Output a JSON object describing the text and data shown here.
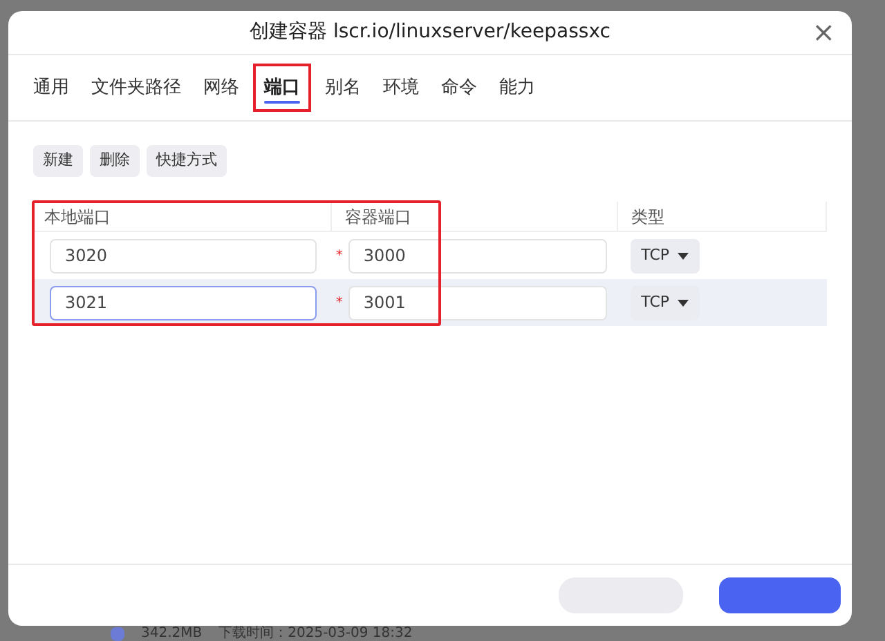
{
  "dialog": {
    "title": "创建容器 lscr.io/linuxserver/keepassxc",
    "close": "×"
  },
  "tabs": [
    {
      "label": "通用",
      "selected": false
    },
    {
      "label": "文件夹路径",
      "selected": false
    },
    {
      "label": "网络",
      "selected": false
    },
    {
      "label": "端口",
      "selected": true
    },
    {
      "label": "别名",
      "selected": false
    },
    {
      "label": "环境",
      "selected": false
    },
    {
      "label": "命令",
      "selected": false
    },
    {
      "label": "能力",
      "selected": false
    }
  ],
  "toolbar": [
    "新建",
    "删除",
    "快捷方式"
  ],
  "table": {
    "columns": [
      "本地端口",
      "容器端口",
      "类型"
    ],
    "rows": [
      {
        "local_port": "3020",
        "container_port": "3000",
        "marker": "*",
        "type": "TCP",
        "selected": false
      },
      {
        "local_port": "3021",
        "container_port": "3001",
        "marker": "*",
        "type": "TCP",
        "selected": true
      }
    ]
  },
  "background": {
    "size": "342.2MB",
    "download_time": "下载时间：2025-03-09 18:32"
  }
}
